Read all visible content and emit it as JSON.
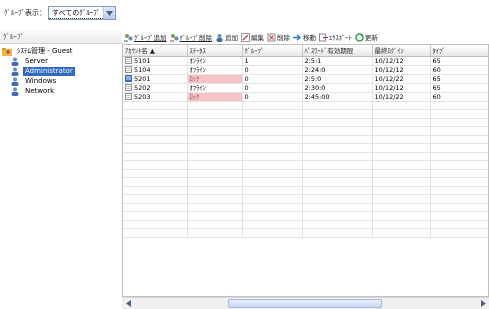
{
  "filter": {
    "label": "ｸﾞﾙｰﾌﾟ表示：",
    "value": "すべてのｸﾞﾙｰﾌﾟ"
  },
  "left_pane": {
    "header": "ｸﾞﾙｰﾌﾟ",
    "tree": [
      {
        "label": "ｼｽﾃﾑ管理 - Guest",
        "level": 0,
        "selected": false
      },
      {
        "label": "Server",
        "level": 1,
        "selected": false
      },
      {
        "label": "Administrator",
        "level": 1,
        "selected": true
      },
      {
        "label": "Windows",
        "level": 1,
        "selected": false
      },
      {
        "label": "Network",
        "level": 1,
        "selected": false
      }
    ]
  },
  "toolbar": {
    "buttons": [
      {
        "label": "ｸﾞﾙｰﾌﾟ追加",
        "icon": "add-group-icon",
        "underlined": true
      },
      {
        "label": "ｸﾞﾙｰﾌﾟ削除",
        "icon": "delete-group-icon",
        "underlined": true
      },
      {
        "label": "追加",
        "icon": "add-user-icon",
        "underlined": false
      },
      {
        "label": "編集",
        "icon": "edit-icon",
        "underlined": false
      },
      {
        "label": "削除",
        "icon": "delete-icon",
        "underlined": false
      },
      {
        "label": "移動",
        "icon": "move-icon",
        "underlined": false
      },
      {
        "label": "ｴｸｽﾎﾟｰﾄ",
        "icon": "export-icon",
        "underlined": false
      },
      {
        "label": "更新",
        "icon": "refresh-icon",
        "underlined": false
      }
    ]
  },
  "grid": {
    "columns": [
      "ｱｶｳﾝﾄ名 ▲",
      "ｽﾃｰﾀｽ",
      "ｸﾞﾙｰﾌﾟ",
      "ﾊﾟｽﾜｰﾄﾞ有効期限",
      "最終ﾛｸﾞｲﾝ",
      "ﾀｲﾌﾟ"
    ],
    "rows": [
      {
        "icon": "doc-icon",
        "cells": [
          "5101",
          "ｵﾝﾗｲﾝ",
          "1",
          "2:5:1",
          "10/12/12",
          "65"
        ],
        "warn": false
      },
      {
        "icon": "doc-icon",
        "cells": [
          "5104",
          "ｵﾌﾗｲﾝ",
          "0",
          "2:24:0",
          "10/12/12",
          "60"
        ],
        "warn": false
      },
      {
        "icon": "monitor-icon",
        "cells": [
          "5201",
          "ﾛｯｸ",
          "0",
          "2:5:0",
          "10/12/22",
          "65"
        ],
        "warn": true
      },
      {
        "icon": "doc-icon",
        "cells": [
          "5202",
          "ｵﾌﾗｲﾝ",
          "0",
          "2:30:0",
          "10/12/12",
          "65"
        ],
        "warn": false
      },
      {
        "icon": "doc-icon",
        "cells": [
          "5203",
          "ﾛｯｸ",
          "0",
          "2:45:00",
          "10/12/22",
          "60"
        ],
        "warn": true
      }
    ],
    "empty_rows": 16
  },
  "scrollbar": {
    "thumb_fraction": 0.45
  },
  "colors": {
    "selection": "#316ac5",
    "warning_cell": "#f5c5c5",
    "header_border": "#7f9db9"
  }
}
